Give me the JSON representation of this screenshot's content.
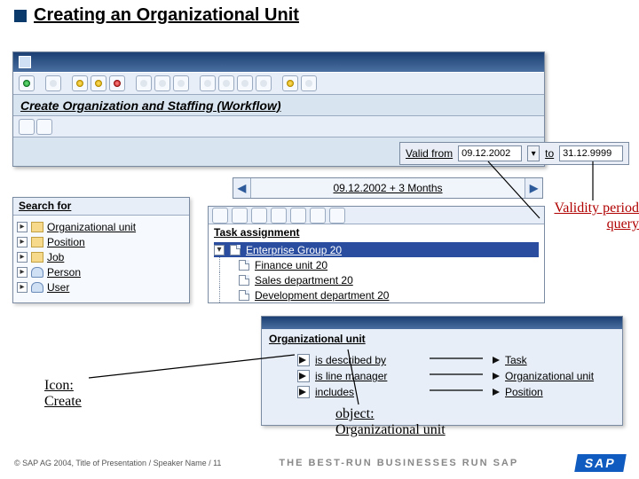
{
  "slide": {
    "title": "Creating an Organizational Unit",
    "subtitle": "Create Organization and Staffing (Workflow)"
  },
  "validity": {
    "from_label": "Valid from",
    "from_value": "09.12.2002",
    "to_label": "to",
    "to_value": "31.12.9999"
  },
  "timebar": {
    "label": "09.12.2002 + 3 Months"
  },
  "search": {
    "header": "Search for",
    "items": [
      {
        "label": "Organizational unit"
      },
      {
        "label": "Position"
      },
      {
        "label": "Job"
      },
      {
        "label": "Person"
      },
      {
        "label": "User"
      }
    ]
  },
  "task": {
    "header": "Task assignment",
    "rows": [
      {
        "label": "Enterprise Group 20",
        "selected": true
      },
      {
        "label": "Finance unit 20"
      },
      {
        "label": "Sales department 20"
      },
      {
        "label": "Development department 20"
      }
    ]
  },
  "rel": {
    "header": "Organizational unit",
    "left": [
      "is described by",
      "is line manager",
      "includes"
    ],
    "right": [
      "Task",
      "Organizational unit",
      "Position"
    ]
  },
  "annotations": {
    "validity_query": "Validity period query",
    "icon_create_l1": "Icon:",
    "icon_create_l2": "Create",
    "object_l1": "object:",
    "object_l2": "Organizational unit"
  },
  "footer": {
    "copyright": "SAP AG 2004, Title of Presentation / Speaker Name / 11",
    "tagline": "THE BEST-RUN BUSINESSES RUN SAP",
    "logo": "SAP"
  }
}
